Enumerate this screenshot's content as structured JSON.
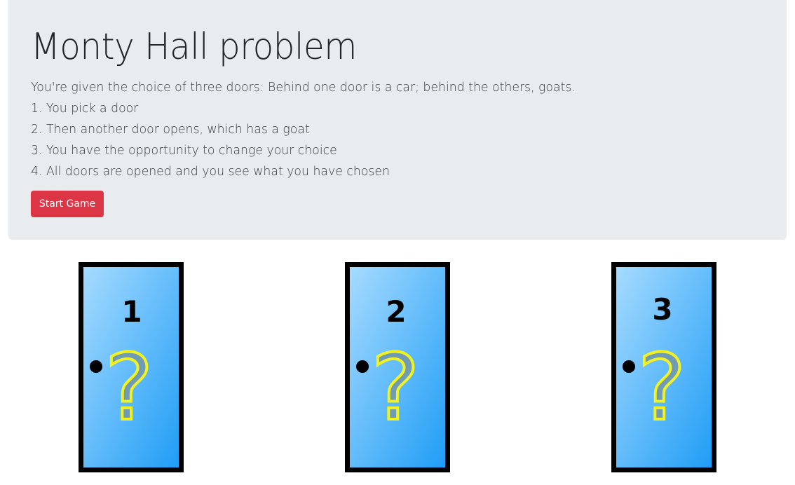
{
  "header": {
    "title": "Monty Hall problem",
    "intro": "You're given the choice of three doors: Behind one door is a car; behind the others, goats.",
    "steps": [
      "1. You pick a door",
      "2. Then another door opens, which has a goat",
      "3. You have the opportunity to change your choice",
      "4. All doors are opened and you see what you have chosen"
    ],
    "start_button": "Start Game"
  },
  "doors": [
    {
      "number": "1",
      "mark": "?"
    },
    {
      "number": "2",
      "mark": "?"
    },
    {
      "number": "3",
      "mark": "?"
    }
  ],
  "colors": {
    "jumbotron_bg": "#e9ecef",
    "button_red": "#dc3545",
    "door_light": "#a8dcff",
    "door_dark": "#1e9cf5",
    "question_fill": "#6f9bb5",
    "question_stroke": "#f2f220"
  }
}
